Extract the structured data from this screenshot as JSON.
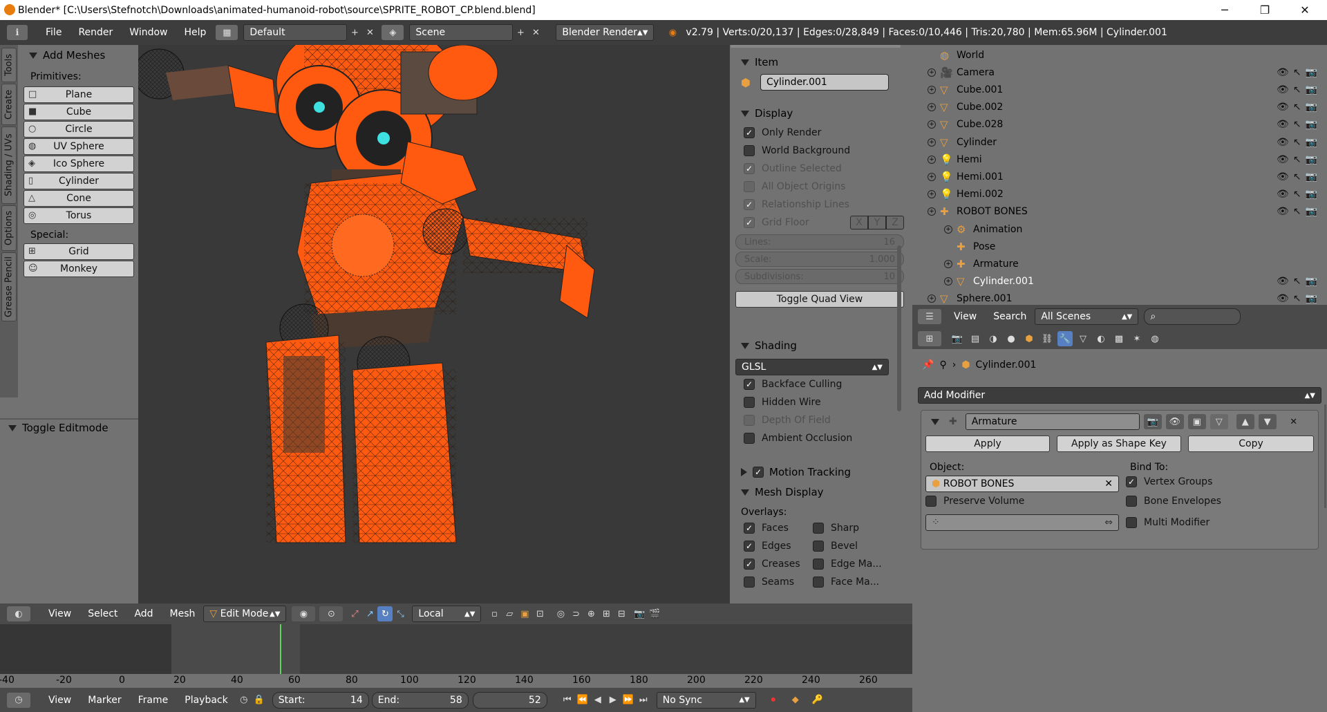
{
  "window": {
    "title": "Blender* [C:\\Users\\Stefnotch\\Downloads\\animated-humanoid-robot\\source\\SPRITE_ROBOT_CP.blend.blend]",
    "minimize": "─",
    "maximize": "❐",
    "close": "✕"
  },
  "topmenu": {
    "items": [
      "File",
      "Render",
      "Window",
      "Help"
    ],
    "layout": "Default",
    "scene": "Scene",
    "engine": "Blender Render",
    "info": "v2.79 | Verts:0/20,137 | Edges:0/28,849 | Faces:0/10,446 | Tris:20,780 | Mem:65.96M | Cylinder.001"
  },
  "toolshelf": {
    "tabs": [
      "Tools",
      "Create",
      "Shading / UVs",
      "Options",
      "Grease Pencil"
    ],
    "panel_title": "Add Meshes",
    "primitives_label": "Primitives:",
    "primitives": [
      "Plane",
      "Cube",
      "Circle",
      "UV Sphere",
      "Ico Sphere",
      "Cylinder",
      "Cone",
      "Torus"
    ],
    "special_label": "Special:",
    "special": [
      "Grid",
      "Monkey"
    ],
    "toggle_editmode": "Toggle Editmode"
  },
  "npanel": {
    "item_title": "Item",
    "object_name": "Cylinder.001",
    "display_title": "Display",
    "display_checks": [
      {
        "label": "Only Render",
        "checked": true,
        "dim": false
      },
      {
        "label": "World Background",
        "checked": false,
        "dim": false
      },
      {
        "label": "Outline Selected",
        "checked": true,
        "dim": true
      },
      {
        "label": "All Object Origins",
        "checked": false,
        "dim": true
      },
      {
        "label": "Relationship Lines",
        "checked": true,
        "dim": true
      }
    ],
    "grid_floor": "Grid Floor",
    "axes": [
      "X",
      "Y",
      "Z"
    ],
    "sliders": [
      {
        "label": "Lines:",
        "value": "16"
      },
      {
        "label": "Scale:",
        "value": "1.000"
      },
      {
        "label": "Subdivisions:",
        "value": "10"
      }
    ],
    "quad_view": "Toggle Quad View",
    "shading_title": "Shading",
    "shading_mode": "GLSL",
    "shading_checks": [
      {
        "label": "Backface Culling",
        "checked": true,
        "dim": false
      },
      {
        "label": "Hidden Wire",
        "checked": false,
        "dim": false
      },
      {
        "label": "Depth Of Field",
        "checked": false,
        "dim": true
      },
      {
        "label": "Ambient Occlusion",
        "checked": false,
        "dim": false
      }
    ],
    "motion_tracking": "Motion Tracking",
    "mesh_display_title": "Mesh Display",
    "overlays_label": "Overlays:",
    "overlays_left": [
      {
        "label": "Faces",
        "checked": true
      },
      {
        "label": "Edges",
        "checked": true
      },
      {
        "label": "Creases",
        "checked": true
      },
      {
        "label": "Seams",
        "checked": false
      }
    ],
    "overlays_right": [
      {
        "label": "Sharp",
        "checked": false
      },
      {
        "label": "Bevel",
        "checked": false
      },
      {
        "label": "Edge Ma...",
        "checked": false
      },
      {
        "label": "Face Ma...",
        "checked": false
      }
    ]
  },
  "outliner": {
    "rows": [
      {
        "label": "World",
        "indent": 0,
        "exp": false,
        "vis": false
      },
      {
        "label": "Camera",
        "indent": 0,
        "exp": true,
        "vis": true
      },
      {
        "label": "Cube.001",
        "indent": 0,
        "exp": true,
        "vis": true
      },
      {
        "label": "Cube.002",
        "indent": 0,
        "exp": true,
        "vis": true
      },
      {
        "label": "Cube.028",
        "indent": 0,
        "exp": true,
        "vis": true
      },
      {
        "label": "Cylinder",
        "indent": 0,
        "exp": true,
        "vis": true
      },
      {
        "label": "Hemi",
        "indent": 0,
        "exp": true,
        "vis": true
      },
      {
        "label": "Hemi.001",
        "indent": 0,
        "exp": true,
        "vis": true
      },
      {
        "label": "Hemi.002",
        "indent": 0,
        "exp": true,
        "vis": true
      },
      {
        "label": "ROBOT BONES",
        "indent": 0,
        "exp": true,
        "vis": true
      },
      {
        "label": "Animation",
        "indent": 1,
        "exp": true,
        "vis": false
      },
      {
        "label": "Pose",
        "indent": 1,
        "exp": false,
        "vis": false
      },
      {
        "label": "Armature",
        "indent": 1,
        "exp": true,
        "vis": false
      },
      {
        "label": "Cylinder.001",
        "indent": 1,
        "exp": true,
        "vis": true,
        "selected": true
      },
      {
        "label": "Sphere.001",
        "indent": 0,
        "exp": true,
        "vis": true
      }
    ],
    "header": {
      "view": "View",
      "search": "Search",
      "scenes": "All Scenes"
    }
  },
  "properties": {
    "breadcrumb": "Cylinder.001",
    "add_modifier": "Add Modifier",
    "modifier_name": "Armature",
    "apply": "Apply",
    "apply_shape": "Apply as Shape Key",
    "copy": "Copy",
    "object_label": "Object:",
    "object_value": "ROBOT BONES",
    "bind_label": "Bind To:",
    "preserve_volume": "Preserve Volume",
    "vertex_groups": "Vertex Groups",
    "bone_envelopes": "Bone Envelopes",
    "multi_modifier": "Multi Modifier"
  },
  "view3d_header": {
    "items": [
      "View",
      "Select",
      "Add",
      "Mesh"
    ],
    "mode": "Edit Mode",
    "orientation": "Local"
  },
  "timeline": {
    "ticks": [
      "-40",
      "-20",
      "0",
      "20",
      "40",
      "60",
      "80",
      "100",
      "120",
      "140",
      "160",
      "180",
      "200",
      "220",
      "240",
      "260"
    ],
    "items": [
      "View",
      "Marker",
      "Frame",
      "Playback"
    ],
    "start_label": "Start:",
    "start": "14",
    "end_label": "End:",
    "end": "58",
    "current": "52",
    "sync": "No Sync"
  }
}
